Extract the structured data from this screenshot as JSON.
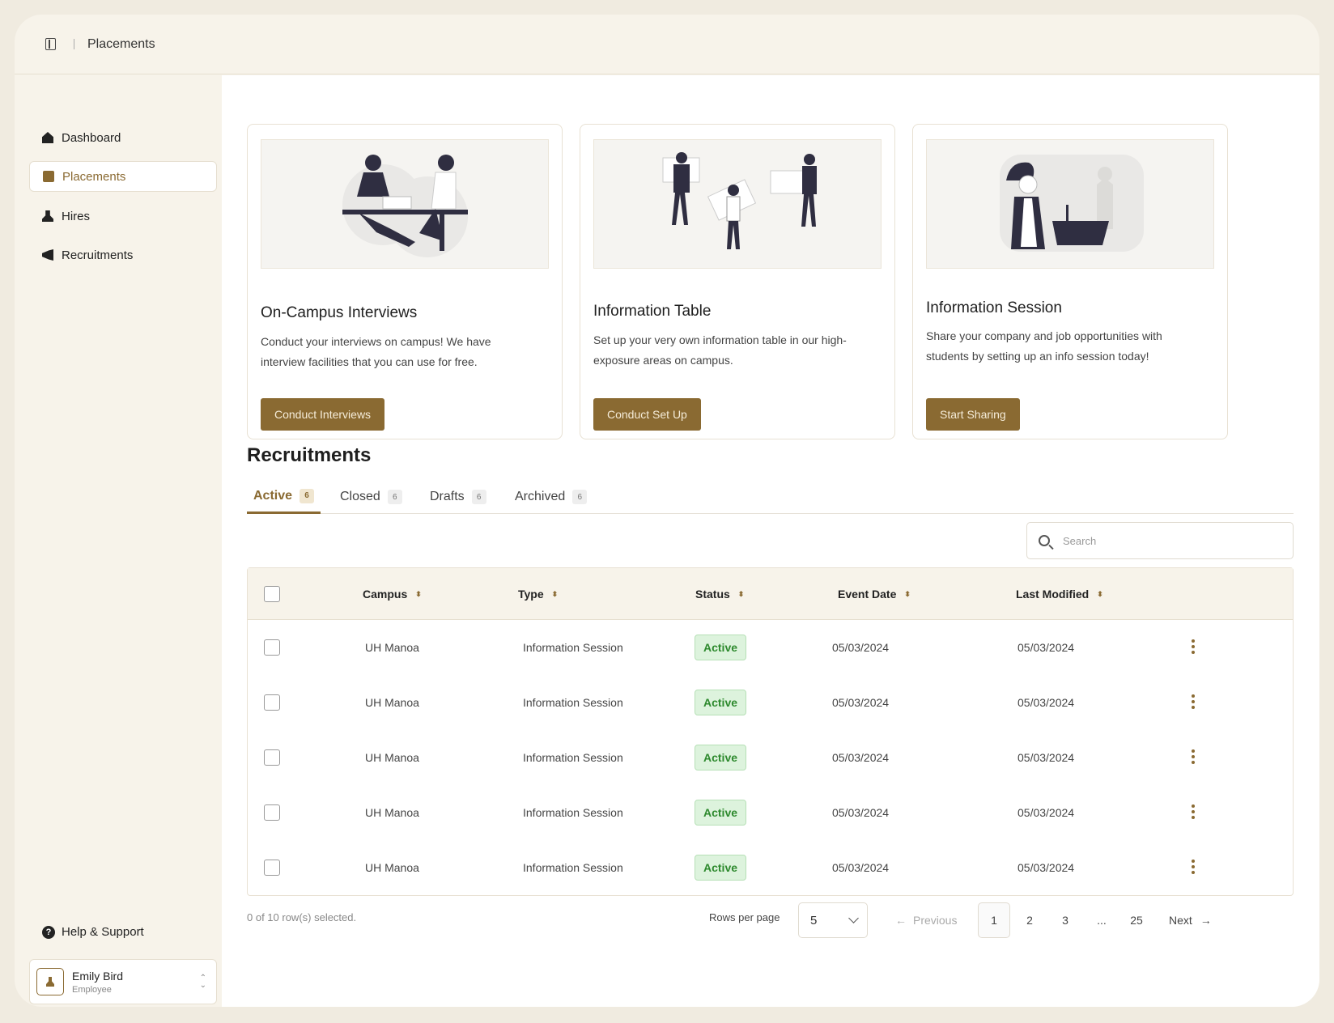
{
  "topbar": {
    "breadcrumb": "Placements"
  },
  "sidebar": {
    "items": [
      {
        "label": "Dashboard",
        "icon": "home-icon"
      },
      {
        "label": "Placements",
        "icon": "briefcase-icon"
      },
      {
        "label": "Hires",
        "icon": "user-icon"
      },
      {
        "label": "Recruitments",
        "icon": "megaphone-icon"
      }
    ],
    "active": "Placements",
    "help_label": "Help & Support",
    "user": {
      "name": "Emily Bird",
      "role": "Employee"
    }
  },
  "cards": [
    {
      "title": "On-Campus Interviews",
      "description": "Conduct your interviews on campus! We have interview facilities that you can use for free.",
      "button": "Conduct Interviews"
    },
    {
      "title": "Information Table",
      "description": "Set up your very own information table in our high-exposure areas on campus.",
      "button": "Conduct Set Up"
    },
    {
      "title": "Information Session",
      "description": "Share your company and job opportunities with students by setting up an info session today!",
      "button": "Start Sharing"
    }
  ],
  "recruitments": {
    "title": "Recruitments",
    "tabs": [
      {
        "label": "Active",
        "count": "6"
      },
      {
        "label": "Closed",
        "count": "6"
      },
      {
        "label": "Drafts",
        "count": "6"
      },
      {
        "label": "Archived",
        "count": "6"
      }
    ],
    "active_tab": "Active",
    "search_placeholder": "Search",
    "columns": [
      "Campus",
      "Type",
      "Status",
      "Event Date",
      "Last Modified"
    ],
    "rows": [
      {
        "campus": "UH Manoa",
        "type": "Information Session",
        "status": "Active",
        "event_date": "05/03/2024",
        "last_modified": "05/03/2024"
      },
      {
        "campus": "UH Manoa",
        "type": "Information Session",
        "status": "Active",
        "event_date": "05/03/2024",
        "last_modified": "05/03/2024"
      },
      {
        "campus": "UH Manoa",
        "type": "Information Session",
        "status": "Active",
        "event_date": "05/03/2024",
        "last_modified": "05/03/2024"
      },
      {
        "campus": "UH Manoa",
        "type": "Information Session",
        "status": "Active",
        "event_date": "05/03/2024",
        "last_modified": "05/03/2024"
      },
      {
        "campus": "UH Manoa",
        "type": "Information Session",
        "status": "Active",
        "event_date": "05/03/2024",
        "last_modified": "05/03/2024"
      }
    ],
    "selection_text": "0 of 10 row(s) selected.",
    "rows_per_page_label": "Rows per page",
    "rows_per_page": "5",
    "pagination": {
      "previous": "Previous",
      "pages": [
        "1",
        "2",
        "3",
        "...",
        "25"
      ],
      "current": "1",
      "next": "Next"
    }
  },
  "colors": {
    "accent": "#8a6a32",
    "status_active_bg": "#ddf3dd",
    "status_active_text": "#2e8a2e",
    "sidebar_bg": "#f7f3ea"
  }
}
